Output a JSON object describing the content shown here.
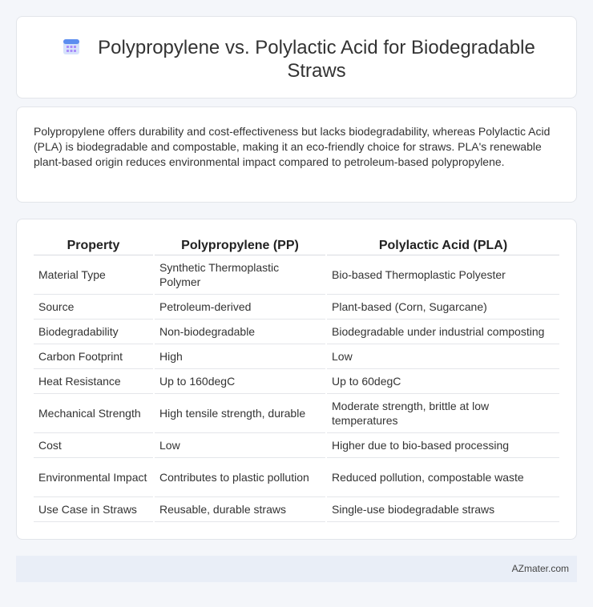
{
  "header": {
    "title": "Polypropylene vs. Polylactic Acid for Biodegradable Straws",
    "icon": "calendar-icon"
  },
  "summary": {
    "text": "Polypropylene offers durability and cost-effectiveness but lacks biodegradability, whereas Polylactic Acid (PLA) is biodegradable and compostable, making it an eco-friendly choice for straws. PLA's renewable plant-based origin reduces environmental impact compared to petroleum-based polypropylene."
  },
  "table": {
    "headers": [
      "Property",
      "Polypropylene (PP)",
      "Polylactic Acid (PLA)"
    ],
    "rows": [
      [
        "Material Type",
        "Synthetic Thermoplastic Polymer",
        "Bio-based Thermoplastic Polyester"
      ],
      [
        "Source",
        "Petroleum-derived",
        "Plant-based (Corn, Sugarcane)"
      ],
      [
        "Biodegradability",
        "Non-biodegradable",
        "Biodegradable under industrial composting"
      ],
      [
        "Carbon Footprint",
        "High",
        "Low"
      ],
      [
        "Heat Resistance",
        "Up to 160degC",
        "Up to 60degC"
      ],
      [
        "Mechanical Strength",
        "High tensile strength, durable",
        "Moderate strength, brittle at low temperatures"
      ],
      [
        "Cost",
        "Low",
        "Higher due to bio-based processing"
      ],
      [
        "Environmental Impact",
        "Contributes to plastic pollution",
        "Reduced pollution, compostable waste"
      ],
      [
        "Use Case in Straws",
        "Reusable, durable straws",
        "Single-use biodegradable straws"
      ]
    ]
  },
  "footer": {
    "site": "AZmater.com"
  },
  "colors": {
    "background": "#f4f6fa",
    "card": "#ffffff",
    "footer": "#e9eef7",
    "icon_blue": "#5b8def",
    "icon_purple": "#a78bfa"
  }
}
